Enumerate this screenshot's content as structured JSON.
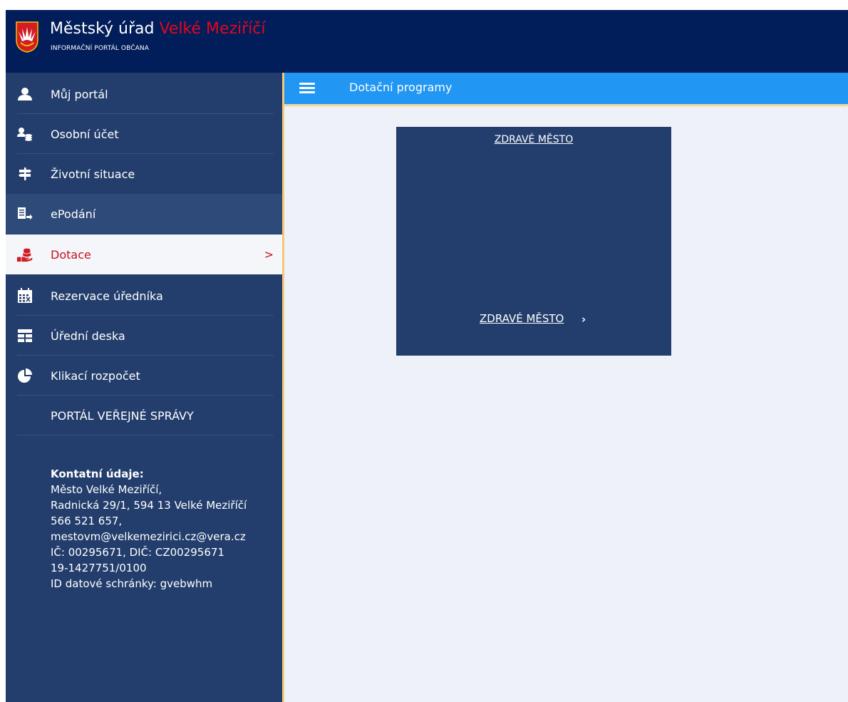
{
  "header": {
    "title_main": "Městský úřad",
    "title_town": "Velké Meziříčí",
    "subtitle": "INFORMAČNÍ PORTÁL OBČANA"
  },
  "topbar": {
    "page_title": "Dotační programy"
  },
  "sidebar": {
    "items": [
      {
        "label": "Můj portál",
        "icon": "user-icon"
      },
      {
        "label": "Osobní účet",
        "icon": "user-coins-icon"
      },
      {
        "label": "Životní situace",
        "icon": "signpost-icon"
      },
      {
        "label": "ePodání",
        "icon": "document-arrow-icon"
      },
      {
        "label": "Dotace",
        "icon": "hand-money-icon",
        "active": true
      },
      {
        "label": "Rezervace úředníka",
        "icon": "calendar-icon"
      },
      {
        "label": "Úřední deska",
        "icon": "board-icon"
      },
      {
        "label": "Klikací rozpočet",
        "icon": "pie-chart-icon"
      },
      {
        "label": "PORTÁL VEŘEJNÉ SPRÁVY"
      }
    ],
    "contact": {
      "heading": "Kontatní údaje:",
      "lines": [
        "Město Velké Meziříčí,",
        "Radnická 29/1, 594 13 Velké Meziříčí",
        "566 521 657,",
        "mestovm@velkemezirici.cz@vera.cz",
        "IČ: 00295671, DIČ: CZ00295671",
        "19-1427751/0100",
        "ID datové schránky: gvebwhm"
      ]
    }
  },
  "tile": {
    "heading": "ZDRAVÉ MĚSTO",
    "link_label": "ZDRAVÉ MĚSTO",
    "chevron": "›"
  },
  "colors": {
    "header_bg": "#021e5a",
    "sidebar_bg": "#233e6c",
    "topbar_bg": "#2196f3",
    "accent_red": "#c8101e",
    "content_bg": "#eef2f8"
  }
}
